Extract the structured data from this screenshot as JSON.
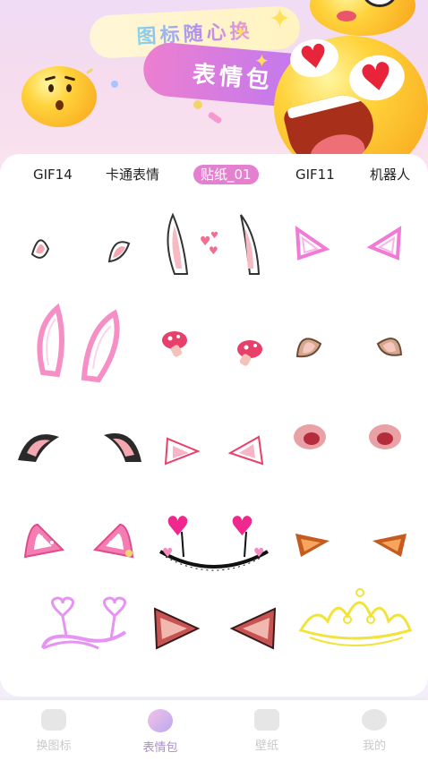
{
  "banner": {
    "title_top": "图标随心换",
    "title_bottom": "表情包"
  },
  "tabs": [
    {
      "label": "GIF14",
      "active": false
    },
    {
      "label": "卡通表情",
      "active": false
    },
    {
      "label": "贴纸_01",
      "active": true
    },
    {
      "label": "GIF11",
      "active": false
    },
    {
      "label": "机器人",
      "active": false
    }
  ],
  "stickers": [
    "bunny-ears-small",
    "bunny-ears-tall",
    "neon-triangle-ears",
    "neon-pink-bunny-ears",
    "mushroom-hair-clips",
    "cat-ears-tan",
    "fluffy-black-ears",
    "white-pink-cat-ears",
    "pink-nose-ears",
    "polka-dot-ears",
    "heart-headband",
    "orange-fox-ears",
    "neon-heart-antennae",
    "devil-cat-ears",
    "neon-yellow-crown"
  ],
  "nav": {
    "items": [
      {
        "label": "换图标",
        "icon": "home-icon",
        "active": false
      },
      {
        "label": "表情包",
        "icon": "emoji-face-icon",
        "active": true
      },
      {
        "label": "壁纸",
        "icon": "image-icon",
        "active": false
      },
      {
        "label": "我的",
        "icon": "profile-face-icon",
        "active": false
      }
    ]
  },
  "colors": {
    "accent": "#e57fd0",
    "nav_active": "#a98ec9",
    "nav_inactive": "#c9c9c9"
  }
}
